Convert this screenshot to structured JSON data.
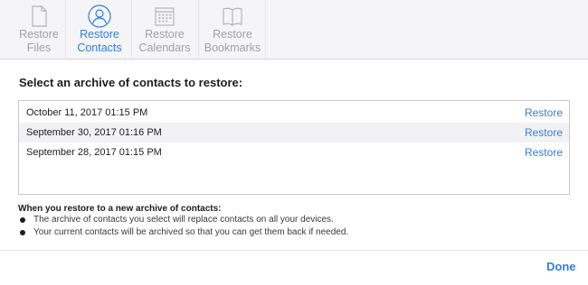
{
  "toolbar": {
    "tabs": [
      {
        "line1": "Restore",
        "line2": "Files",
        "icon": "document-icon"
      },
      {
        "line1": "Restore",
        "line2": "Contacts",
        "icon": "contact-icon"
      },
      {
        "line1": "Restore",
        "line2": "Calendars",
        "icon": "calendar-icon"
      },
      {
        "line1": "Restore",
        "line2": "Bookmarks",
        "icon": "book-icon"
      }
    ],
    "active_tab": "Contacts"
  },
  "heading": "Select an archive of contacts to restore:",
  "archives": [
    {
      "date": "October 11, 2017 01:15 PM",
      "action": "Restore"
    },
    {
      "date": "September 30, 2017 01:16 PM",
      "action": "Restore"
    },
    {
      "date": "September 28, 2017 01:15 PM",
      "action": "Restore"
    }
  ],
  "info": {
    "title": "When you restore to a new archive of contacts:",
    "bullets": [
      "The archive of contacts you select will replace contacts on all your devices.",
      "Your current contacts will be archived so that you can get them back if needed."
    ]
  },
  "footer": {
    "done_label": "Done"
  },
  "colors": {
    "accent": "#2d7fe0",
    "inactive": "#a1a1a6",
    "toolbar_bg": "#f5f5f7"
  }
}
